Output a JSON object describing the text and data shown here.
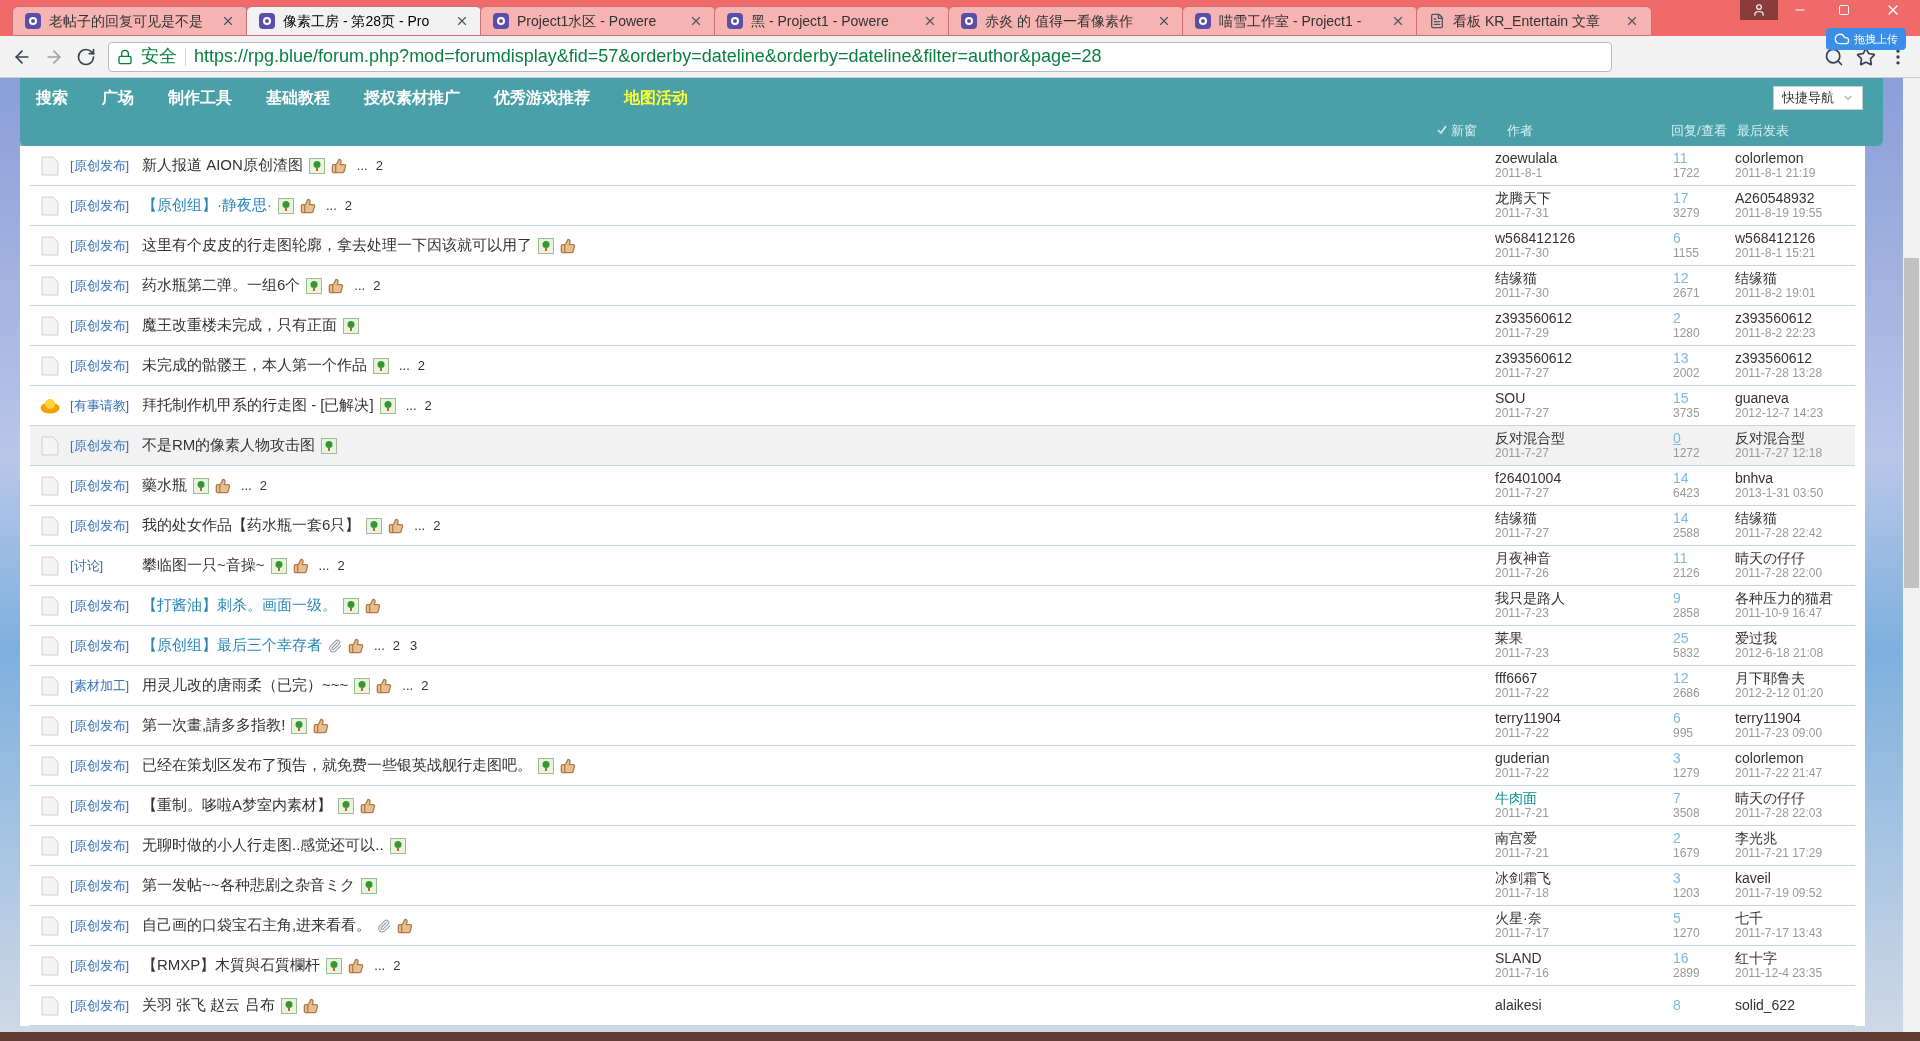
{
  "browser_tabs": [
    {
      "title": "老帖子的回复可见是不是",
      "kind": "site",
      "selected": false
    },
    {
      "title": "像素工房 - 第28页 - Pro",
      "kind": "site",
      "selected": true
    },
    {
      "title": "Project1水区 - Powere",
      "kind": "site",
      "selected": false
    },
    {
      "title": "黑 - Project1 - Powere",
      "kind": "site",
      "selected": false
    },
    {
      "title": "赤炎 的 值得一看像素作",
      "kind": "site",
      "selected": false
    },
    {
      "title": "喵雪工作室 - Project1 -",
      "kind": "site",
      "selected": false
    },
    {
      "title": "看板 KR_Entertain 文章",
      "kind": "page",
      "selected": false
    }
  ],
  "upload_button": "拖拽上传",
  "address_bar": {
    "secure_label": "安全",
    "url": "https://rpg.blue/forum.php?mod=forumdisplay&fid=57&orderby=dateline&orderby=dateline&filter=author&page=28"
  },
  "nav": [
    {
      "label": "搜索",
      "selected": false
    },
    {
      "label": "广场",
      "selected": false
    },
    {
      "label": "制作工具",
      "selected": false
    },
    {
      "label": "基础教程",
      "selected": false
    },
    {
      "label": "授权素材推广",
      "selected": false
    },
    {
      "label": "优秀游戏推荐",
      "selected": false
    },
    {
      "label": "地图活动",
      "selected": true
    }
  ],
  "quick_nav": "快捷导航",
  "columns": {
    "new_window": "新窗",
    "author": "作者",
    "replies_views": "回复/查看",
    "last_post": "最后发表"
  },
  "threads": [
    {
      "kind": "doc",
      "tag": "[原创发布]",
      "title": "新人报道 AION原创渣图",
      "highlight": false,
      "badges": [
        {
          "kind": "image"
        },
        {
          "kind": "thumb"
        }
      ],
      "ellipsis": "...",
      "pages": [
        "2"
      ],
      "author": "zoewulala",
      "author_highlight": false,
      "date": "2011-8-1",
      "replies": "11",
      "views": "1722",
      "last_user": "colorlemon",
      "last_time": "2011-8-1 21:19",
      "selected": false
    },
    {
      "kind": "doc",
      "tag": "[原创发布]",
      "title": "【原创组】·静夜思·",
      "highlight": true,
      "badges": [
        {
          "kind": "image"
        },
        {
          "kind": "thumb"
        }
      ],
      "ellipsis": "...",
      "pages": [
        "2"
      ],
      "author": "龙腾天下",
      "author_highlight": false,
      "date": "2011-7-31",
      "replies": "17",
      "views": "3279",
      "last_user": "A260548932",
      "last_time": "2011-8-19 19:55",
      "selected": false
    },
    {
      "kind": "doc",
      "tag": "[原创发布]",
      "title": "这里有个皮皮的行走图轮廓，拿去处理一下因该就可以用了",
      "highlight": false,
      "badges": [
        {
          "kind": "image"
        },
        {
          "kind": "thumb"
        }
      ],
      "author": "w568412126",
      "author_highlight": false,
      "date": "2011-7-30",
      "replies": "6",
      "views": "1155",
      "last_user": "w568412126",
      "last_time": "2011-8-1 15:21",
      "selected": false
    },
    {
      "kind": "doc",
      "tag": "[原创发布]",
      "title": "药水瓶第二弹。一组6个",
      "highlight": false,
      "badges": [
        {
          "kind": "image"
        },
        {
          "kind": "thumb"
        }
      ],
      "ellipsis": "...",
      "pages": [
        "2"
      ],
      "author": "结缘猫",
      "author_highlight": false,
      "date": "2011-7-30",
      "replies": "12",
      "views": "2671",
      "last_user": "结缘猫",
      "last_time": "2011-8-2 19:01",
      "selected": false
    },
    {
      "kind": "doc",
      "tag": "[原创发布]",
      "title": "魔王改重楼未完成，只有正面",
      "highlight": false,
      "badges": [
        {
          "kind": "image"
        }
      ],
      "author": "z393560612",
      "author_highlight": false,
      "date": "2011-7-29",
      "replies": "2",
      "views": "1280",
      "last_user": "z393560612",
      "last_time": "2011-8-2 22:23",
      "selected": false
    },
    {
      "kind": "doc",
      "tag": "[原创发布]",
      "title": "未完成的骷髅王，本人第一个作品",
      "highlight": false,
      "badges": [
        {
          "kind": "image"
        }
      ],
      "ellipsis": "...",
      "pages": [
        "2"
      ],
      "author": "z393560612",
      "author_highlight": false,
      "date": "2011-7-27",
      "replies": "13",
      "views": "2002",
      "last_user": "z393560612",
      "last_time": "2011-7-28 13:28",
      "selected": false
    },
    {
      "kind": "reward",
      "tag": "[有事请教]",
      "title": "拜托制作机甲系的行走图 - [已解决]",
      "highlight": false,
      "badges": [
        {
          "kind": "image"
        }
      ],
      "ellipsis": "...",
      "pages": [
        "2"
      ],
      "author": "SOU",
      "author_highlight": false,
      "date": "2011-7-27",
      "replies": "15",
      "views": "3735",
      "last_user": "guaneva",
      "last_time": "2012-12-7 14:23",
      "selected": false
    },
    {
      "kind": "doc",
      "tag": "[原创发布]",
      "title": "不是RM的像素人物攻击图",
      "highlight": false,
      "badges": [
        {
          "kind": "image"
        }
      ],
      "author": "反对混合型",
      "author_highlight": false,
      "date": "2011-7-27",
      "replies": "0",
      "views": "1272",
      "last_user": "反对混合型",
      "last_time": "2011-7-27 12:18",
      "selected": true
    },
    {
      "kind": "doc",
      "tag": "[原创发布]",
      "title": "藥水瓶",
      "highlight": false,
      "badges": [
        {
          "kind": "image"
        },
        {
          "kind": "thumb"
        }
      ],
      "ellipsis": "...",
      "pages": [
        "2"
      ],
      "author": "f26401004",
      "author_highlight": false,
      "date": "2011-7-27",
      "replies": "14",
      "views": "6423",
      "last_user": "bnhva",
      "last_time": "2013-1-31 03:50",
      "selected": false
    },
    {
      "kind": "doc",
      "tag": "[原创发布]",
      "title": "我的处女作品【药水瓶一套6只】",
      "highlight": false,
      "badges": [
        {
          "kind": "image"
        },
        {
          "kind": "thumb"
        }
      ],
      "ellipsis": "...",
      "pages": [
        "2"
      ],
      "author": "结缘猫",
      "author_highlight": false,
      "date": "2011-7-27",
      "replies": "14",
      "views": "2588",
      "last_user": "结缘猫",
      "last_time": "2011-7-28 22:42",
      "selected": false
    },
    {
      "kind": "doc",
      "tag": "[讨论]",
      "title": "攀临图一只~音操~",
      "highlight": false,
      "badges": [
        {
          "kind": "image"
        },
        {
          "kind": "thumb"
        }
      ],
      "ellipsis": "...",
      "pages": [
        "2"
      ],
      "author": "月夜神音",
      "author_highlight": false,
      "date": "2011-7-26",
      "replies": "11",
      "views": "2126",
      "last_user": "晴天の仔仔",
      "last_time": "2011-7-28 22:00",
      "selected": false
    },
    {
      "kind": "doc",
      "tag": "[原创发布]",
      "title": "【打酱油】刺杀。画面一级。",
      "highlight": true,
      "badges": [
        {
          "kind": "image"
        },
        {
          "kind": "thumb"
        }
      ],
      "author": "我只是路人",
      "author_highlight": false,
      "date": "2011-7-23",
      "replies": "9",
      "views": "2858",
      "last_user": "各种压力的猫君",
      "last_time": "2011-10-9 16:47",
      "selected": false
    },
    {
      "kind": "doc",
      "tag": "[原创发布]",
      "title": "【原创组】最后三个幸存者",
      "highlight": true,
      "badges": [
        {
          "kind": "attachment"
        },
        {
          "kind": "thumb"
        }
      ],
      "ellipsis": "...",
      "pages": [
        "2",
        "3"
      ],
      "author": "莱果",
      "author_highlight": false,
      "date": "2011-7-23",
      "replies": "25",
      "views": "5832",
      "last_user": "爱过我",
      "last_time": "2012-6-18 21:08",
      "selected": false
    },
    {
      "kind": "doc",
      "tag": "[素材加工]",
      "title": "用灵儿改的唐雨柔（已完）~~~",
      "highlight": false,
      "badges": [
        {
          "kind": "image"
        },
        {
          "kind": "thumb"
        }
      ],
      "ellipsis": "...",
      "pages": [
        "2"
      ],
      "author": "fff6667",
      "author_highlight": false,
      "date": "2011-7-22",
      "replies": "12",
      "views": "2686",
      "last_user": "月下耶鲁夫",
      "last_time": "2012-2-12 01:20",
      "selected": false
    },
    {
      "kind": "doc",
      "tag": "[原创发布]",
      "title": "第一次畫,請多多指教!",
      "highlight": false,
      "badges": [
        {
          "kind": "image"
        },
        {
          "kind": "thumb"
        }
      ],
      "author": "terry11904",
      "author_highlight": false,
      "date": "2011-7-22",
      "replies": "6",
      "views": "995",
      "last_user": "terry11904",
      "last_time": "2011-7-23 09:00",
      "selected": false
    },
    {
      "kind": "doc",
      "tag": "[原创发布]",
      "title": "已经在策划区发布了预告，就免费一些银英战舰行走图吧。",
      "highlight": false,
      "badges": [
        {
          "kind": "image"
        },
        {
          "kind": "thumb"
        }
      ],
      "author": "guderian",
      "author_highlight": false,
      "date": "2011-7-22",
      "replies": "3",
      "views": "1279",
      "last_user": "colorlemon",
      "last_time": "2011-7-22 21:47",
      "selected": false
    },
    {
      "kind": "doc",
      "tag": "[原创发布]",
      "title": "【重制。哆啦A梦室内素材】",
      "highlight": false,
      "badges": [
        {
          "kind": "image"
        },
        {
          "kind": "thumb"
        }
      ],
      "author": "牛肉面",
      "author_highlight": true,
      "date": "2011-7-21",
      "replies": "7",
      "views": "3508",
      "last_user": "晴天の仔仔",
      "last_time": "2011-7-28 22:03",
      "selected": false
    },
    {
      "kind": "doc",
      "tag": "[原创发布]",
      "title": "无聊时做的小人行走图..感觉还可以..",
      "highlight": false,
      "badges": [
        {
          "kind": "image"
        }
      ],
      "author": "南宫爱",
      "author_highlight": false,
      "date": "2011-7-21",
      "replies": "2",
      "views": "1679",
      "last_user": "李光兆",
      "last_time": "2011-7-21 17:29",
      "selected": false
    },
    {
      "kind": "doc",
      "tag": "[原创发布]",
      "title": "第一发帖~~各种悲剧之杂音ミク",
      "highlight": false,
      "badges": [
        {
          "kind": "image"
        }
      ],
      "author": "冰剑霜飞",
      "author_highlight": false,
      "date": "2011-7-18",
      "replies": "3",
      "views": "1203",
      "last_user": "kaveil",
      "last_time": "2011-7-19 09:52",
      "selected": false
    },
    {
      "kind": "doc",
      "tag": "[原创发布]",
      "title": "自己画的口袋宝石主角,进来看看。",
      "highlight": false,
      "badges": [
        {
          "kind": "attachment"
        },
        {
          "kind": "thumb"
        }
      ],
      "author": "火星·奈",
      "author_highlight": false,
      "date": "2011-7-17",
      "replies": "5",
      "views": "1270",
      "last_user": "七千",
      "last_time": "2011-7-17 13:43",
      "selected": false
    },
    {
      "kind": "doc",
      "tag": "[原创发布]",
      "title": "【RMXP】木質與石質欄杆",
      "highlight": false,
      "badges": [
        {
          "kind": "image"
        },
        {
          "kind": "thumb"
        }
      ],
      "ellipsis": "...",
      "pages": [
        "2"
      ],
      "author": "SLAND",
      "author_highlight": false,
      "date": "2011-7-16",
      "replies": "16",
      "views": "2899",
      "last_user": "红十字",
      "last_time": "2011-12-4 23:35",
      "selected": false
    },
    {
      "kind": "doc",
      "tag": "[原创发布]",
      "title": "关羽 张飞 赵云 吕布",
      "highlight": false,
      "badges": [
        {
          "kind": "image"
        },
        {
          "kind": "thumb"
        }
      ],
      "author": "alaikesi",
      "author_highlight": false,
      "replies": "8",
      "last_user": "solid_622",
      "selected": false
    }
  ]
}
